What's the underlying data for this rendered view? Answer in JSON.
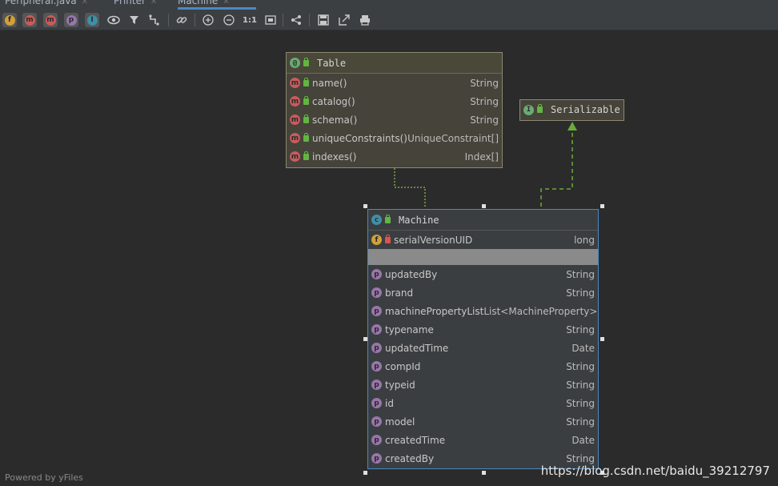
{
  "tabs": [
    {
      "label": "Peripheral.java"
    },
    {
      "label": "Printer"
    },
    {
      "label": "Machine",
      "active": true
    }
  ],
  "toolbar": {
    "filters": [
      "f",
      "m",
      "m",
      "p",
      "I"
    ],
    "scale_label": "1:1"
  },
  "table_node": {
    "title": "Table",
    "rows": [
      {
        "name": "name()",
        "type": "String"
      },
      {
        "name": "catalog()",
        "type": "String"
      },
      {
        "name": "schema()",
        "type": "String"
      },
      {
        "name": "uniqueConstraints()",
        "type": "UniqueConstraint[]"
      },
      {
        "name": "indexes()",
        "type": "Index[]"
      }
    ]
  },
  "serializable_node": {
    "title": "Serializable"
  },
  "machine_node": {
    "title": "Machine",
    "field": {
      "name": "serialVersionUID",
      "type": "long"
    },
    "properties": [
      {
        "name": "updatedBy",
        "type": "String"
      },
      {
        "name": "brand",
        "type": "String"
      },
      {
        "name": "machinePropertyList",
        "type": "List<MachineProperty>"
      },
      {
        "name": "typename",
        "type": "String"
      },
      {
        "name": "updatedTime",
        "type": "Date"
      },
      {
        "name": "compId",
        "type": "String"
      },
      {
        "name": "typeid",
        "type": "String"
      },
      {
        "name": "id",
        "type": "String"
      },
      {
        "name": "model",
        "type": "String"
      },
      {
        "name": "createdTime",
        "type": "Date"
      },
      {
        "name": "createdBy",
        "type": "String"
      }
    ]
  },
  "footer": "Powered by yFiles",
  "watermark": "https://blog.csdn.net/baidu_39212797",
  "colors": {
    "annotation_badge": "#6aab73",
    "method_badge": "#c75c5c",
    "property_badge": "#9876aa",
    "field_badge": "#d1a03a",
    "class_badge": "#3f8fa6",
    "interface_badge": "#6aab73",
    "selection_border": "#4a88c7"
  }
}
